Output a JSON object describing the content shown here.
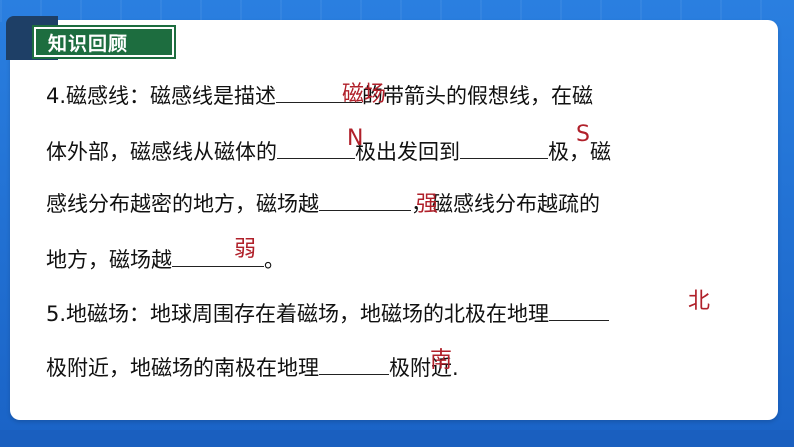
{
  "section_title": "知识回顾",
  "q4": {
    "line1_a": "4.磁感线：磁感线是描述",
    "line1_b": "的带箭头的假想线，在磁",
    "line2_a": "体外部，磁感线从磁体的",
    "line2_b": "极出发回到",
    "line2_c": "极，磁",
    "line3_a": "感线分布越密的地方，磁场越",
    "line3_b": "，磁感线分布越疏的",
    "line4_a": "地方，磁场越",
    "line4_b": "。",
    "answers": [
      "磁场",
      "N",
      "S",
      "强",
      "弱"
    ]
  },
  "q5": {
    "line1_a": "5.地磁场：地球周围存在着磁场，地磁场的北极在地理",
    "line2_a": "极附近，地磁场的南极在地理",
    "line2_b": "极附近.",
    "answers": [
      "北",
      "南"
    ]
  },
  "colors": {
    "frame": "#1f6fd1",
    "tag": "#1d6d3f",
    "answer": "#b0202a"
  }
}
